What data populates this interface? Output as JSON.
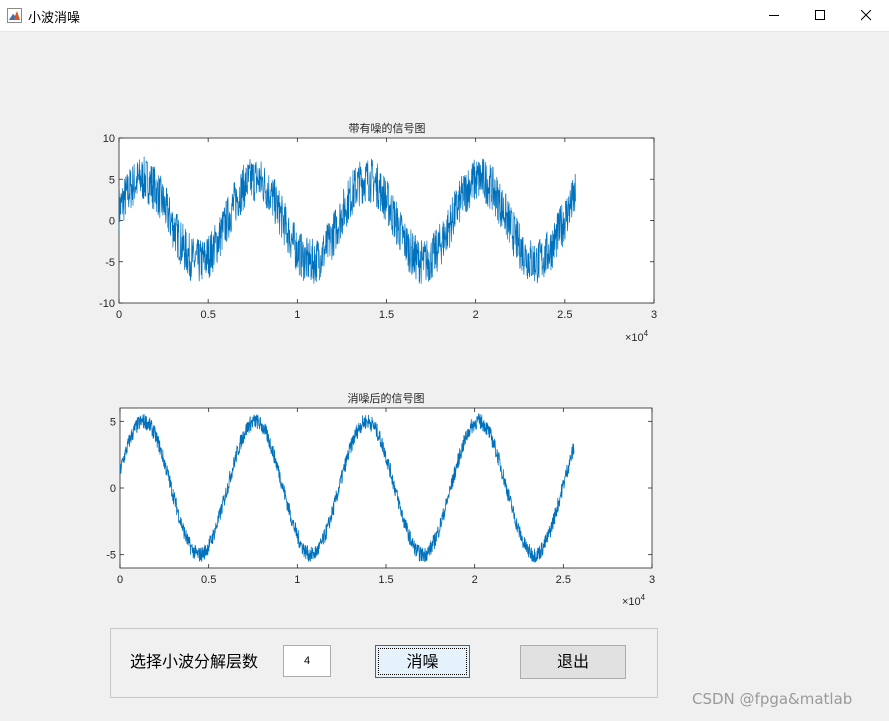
{
  "window": {
    "title": "小波消噪",
    "icon": "matlab-figure-icon"
  },
  "chart_data": [
    {
      "type": "line",
      "title": "带有噪的信号图",
      "xlim": [
        0,
        30000
      ],
      "ylim": [
        -10,
        10
      ],
      "x_ticks": [
        "0",
        "0.5",
        "1",
        "1.5",
        "2",
        "2.5",
        "3"
      ],
      "y_ticks": [
        "10",
        "5",
        "0",
        "-5",
        "-10"
      ],
      "x_exponent": "×10",
      "x_exponent_power": "4",
      "x_end": 25600,
      "series": [
        {
          "color": "#0072bd",
          "shape": "noisy sine",
          "amplitude": 5,
          "period": 6300,
          "noise": 2.8
        }
      ],
      "box": true
    },
    {
      "type": "line",
      "title": "消噪后的信号图",
      "xlim": [
        0,
        30000
      ],
      "ylim": [
        -6,
        6
      ],
      "x_ticks": [
        "0",
        "0.5",
        "1",
        "1.5",
        "2",
        "2.5",
        "3"
      ],
      "y_ticks": [
        "5",
        "0",
        "-5"
      ],
      "y_tick_values": [
        5,
        0,
        -5
      ],
      "x_exponent": "×10",
      "x_exponent_power": "4",
      "x_end": 25600,
      "series": [
        {
          "color": "#0072bd",
          "shape": "sine",
          "amplitude": 5,
          "period": 6300,
          "noise": 0.6
        }
      ],
      "box": true
    }
  ],
  "controls": {
    "level_label": "选择小波分解层数",
    "level_value": "4",
    "denoise_label": "消噪",
    "exit_label": "退出"
  },
  "watermark": "CSDN @fpga&matlab"
}
